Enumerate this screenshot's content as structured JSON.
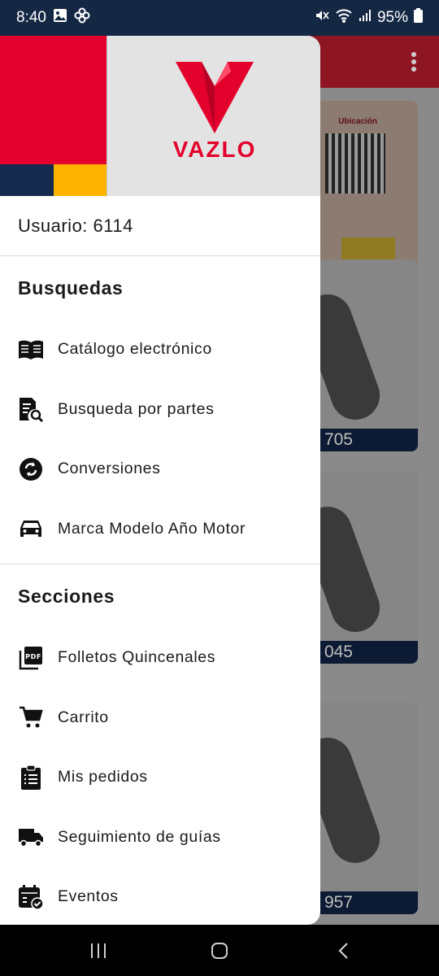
{
  "status_bar": {
    "time": "8:40",
    "battery": "95%"
  },
  "background": {
    "banner_location_label": "Ubicación",
    "card_codes": [
      "705",
      "045",
      "957"
    ]
  },
  "drawer": {
    "logo_text": "VAZLO",
    "user_label": "Usuario: 6114",
    "sections": [
      {
        "title": "Busquedas",
        "items": [
          {
            "label": "Catálogo electrónico",
            "icon": "book-icon"
          },
          {
            "label": "Busqueda por partes",
            "icon": "document-search-icon"
          },
          {
            "label": "Conversiones",
            "icon": "sync-icon"
          },
          {
            "label": "Marca Modelo Año Motor",
            "icon": "car-icon"
          }
        ]
      },
      {
        "title": "Secciones",
        "items": [
          {
            "label": "Folletos Quincenales",
            "icon": "pdf-icon"
          },
          {
            "label": "Carrito",
            "icon": "cart-icon"
          },
          {
            "label": "Mis pedidos",
            "icon": "clipboard-list-icon"
          },
          {
            "label": "Seguimiento de guías",
            "icon": "truck-icon"
          },
          {
            "label": "Eventos",
            "icon": "calendar-check-icon"
          }
        ]
      }
    ]
  },
  "colors": {
    "brand_red": "#e3002c",
    "brand_navy": "#152a4c",
    "brand_yellow": "#fbb300"
  }
}
